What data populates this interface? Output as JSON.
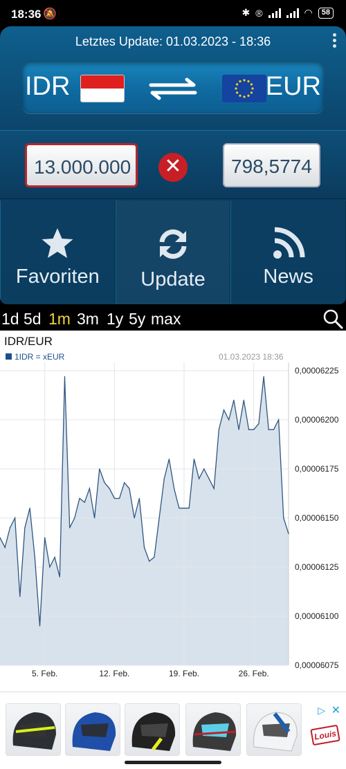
{
  "status_bar": {
    "time": "18:36",
    "battery": "58"
  },
  "header": {
    "last_update": "Letztes Update: 01.03.2023 - 18:36"
  },
  "pair": {
    "from": "IDR",
    "to": "EUR"
  },
  "converter": {
    "from_amount": "13.000.000",
    "to_amount": "798,5774"
  },
  "nav": [
    {
      "label": "Favoriten",
      "icon": "star-icon"
    },
    {
      "label": "Update",
      "icon": "refresh-icon"
    },
    {
      "label": "News",
      "icon": "rss-icon"
    }
  ],
  "ranges": {
    "options": [
      "1d",
      "5d",
      "1m",
      "3m",
      "1y",
      "5y",
      "max"
    ],
    "active": "1m"
  },
  "colors": {
    "accent": "#f0d33c",
    "line": "#2f5580",
    "fill": "#d8e2ec",
    "clear": "#c62026"
  },
  "chart_data": {
    "type": "area",
    "title": "IDR/EUR",
    "legend": "1IDR = xEUR",
    "timestamp": "01.03.2023 18:36",
    "x_ticks": [
      "5. Feb.",
      "12. Feb.",
      "19. Feb.",
      "26. Feb."
    ],
    "y_ticks": [
      "0,00006225",
      "0,00006200",
      "0,00006175",
      "0,00006150",
      "0,00006125",
      "0,00006100",
      "0,00006075"
    ],
    "ylim": [
      6.075e-05,
      6.225e-05
    ],
    "grid": true,
    "x_days": [
      0,
      0.5,
      1,
      1.5,
      2,
      2.5,
      3,
      3.5,
      4,
      4.5,
      5,
      5.5,
      6,
      6.5,
      7,
      7.5,
      8,
      8.5,
      9,
      9.5,
      10,
      10.5,
      11,
      11.5,
      12,
      12.5,
      13,
      13.5,
      14,
      14.5,
      15,
      15.5,
      16,
      16.5,
      17,
      17.5,
      18,
      18.5,
      19,
      19.5,
      20,
      20.5,
      21,
      21.5,
      22,
      22.5,
      23,
      23.5,
      24,
      24.5,
      25,
      25.5,
      26,
      26.5,
      27,
      27.5,
      28,
      28.5,
      29
    ],
    "values": [
      6.14e-05,
      6.135e-05,
      6.145e-05,
      6.15e-05,
      6.11e-05,
      6.145e-05,
      6.155e-05,
      6.13e-05,
      6.095e-05,
      6.14e-05,
      6.125e-05,
      6.13e-05,
      6.12e-05,
      6.222e-05,
      6.145e-05,
      6.15e-05,
      6.16e-05,
      6.158e-05,
      6.165e-05,
      6.15e-05,
      6.175e-05,
      6.168e-05,
      6.165e-05,
      6.16e-05,
      6.16e-05,
      6.168e-05,
      6.165e-05,
      6.15e-05,
      6.16e-05,
      6.135e-05,
      6.128e-05,
      6.13e-05,
      6.15e-05,
      6.17e-05,
      6.18e-05,
      6.165e-05,
      6.155e-05,
      6.155e-05,
      6.155e-05,
      6.18e-05,
      6.17e-05,
      6.175e-05,
      6.17e-05,
      6.165e-05,
      6.195e-05,
      6.205e-05,
      6.2e-05,
      6.21e-05,
      6.195e-05,
      6.21e-05,
      6.195e-05,
      6.195e-05,
      6.198e-05,
      6.222e-05,
      6.195e-05,
      6.195e-05,
      6.2e-05,
      6.15e-05,
      6.142e-05
    ]
  },
  "ad": {
    "brand": "Louis"
  }
}
